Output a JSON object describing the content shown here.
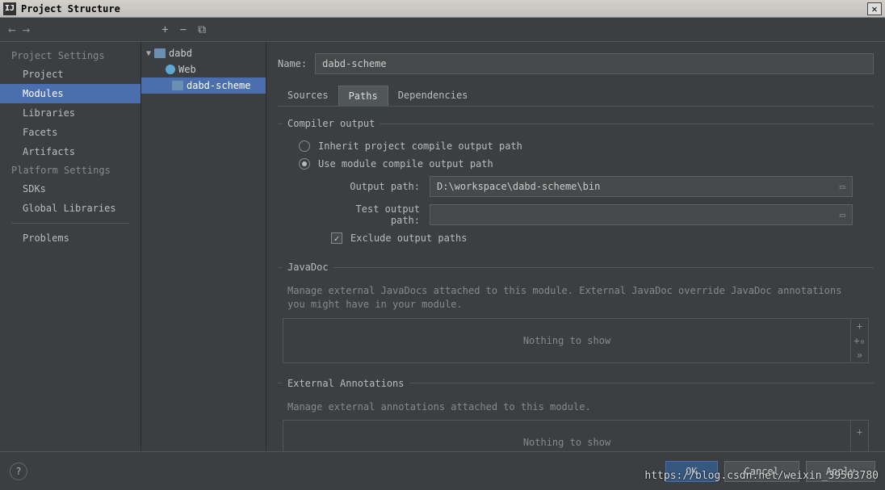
{
  "window": {
    "title": "Project Structure"
  },
  "nav": {
    "back": "←",
    "forward": "→"
  },
  "toolbar": {
    "add": "+",
    "remove": "−",
    "copy": "⧉"
  },
  "sidebar": {
    "settings_heading": "Project Settings",
    "project": "Project",
    "modules": "Modules",
    "libraries": "Libraries",
    "facets": "Facets",
    "artifacts": "Artifacts",
    "platform_heading": "Platform Settings",
    "sdks": "SDKs",
    "global_libs": "Global Libraries",
    "problems": "Problems"
  },
  "tree": {
    "root": "dabd",
    "web": "Web",
    "module": "dabd-scheme"
  },
  "form": {
    "name_label": "Name:",
    "name_value": "dabd-scheme"
  },
  "tabs": {
    "sources": "Sources",
    "paths": "Paths",
    "deps": "Dependencies"
  },
  "compiler": {
    "legend": "Compiler output",
    "inherit": "Inherit project compile output path",
    "use_module": "Use module compile output path",
    "output_label": "Output path:",
    "output_value": "D:\\workspace\\dabd-scheme\\bin",
    "test_label": "Test output path:",
    "test_value": "",
    "exclude": "Exclude output paths"
  },
  "javadoc": {
    "legend": "JavaDoc",
    "desc": "Manage external JavaDocs attached to this module. External JavaDoc override JavaDoc annotations you might have in your module.",
    "nothing": "Nothing to show"
  },
  "annotations": {
    "legend": "External Annotations",
    "desc": "Manage external annotations attached to this module.",
    "nothing": "Nothing to show"
  },
  "buttons": {
    "ok": "OK",
    "cancel": "Cancel",
    "apply": "Apply",
    "help": "?"
  },
  "watermark": "https://blog.csdn.net/weixin_39563780"
}
